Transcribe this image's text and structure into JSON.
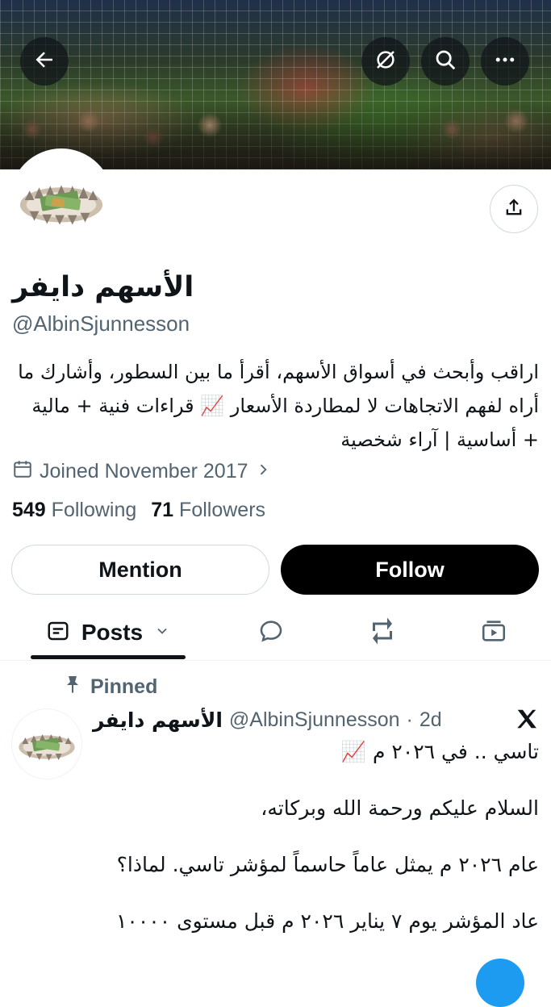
{
  "profile": {
    "display_name": "الأسهم دايفر",
    "handle": "@AlbinSjunnesson",
    "bio": "اراقب وأبحث في أسواق الأسهم، أقرأ ما بين السطور، وأشارك ما أراه لفهم الاتجاهات لا لمطاردة الأسعار 📈 قراءات فنية + مالية + أساسية | آراء شخصية",
    "joined": "Joined November 2017",
    "following_count": "549",
    "following_label": "Following",
    "followers_count": "71",
    "followers_label": "Followers"
  },
  "actions": {
    "mention_label": "Mention",
    "follow_label": "Follow"
  },
  "header_icons": [
    "back-arrow-icon",
    "hide-icon",
    "search-icon",
    "more-icon",
    "share-icon"
  ],
  "tabs": {
    "posts_label": "Posts",
    "icons": [
      "posts-icon",
      "chevron-down-icon",
      "reply-icon",
      "repost-icon",
      "media-icon"
    ]
  },
  "pinned_post": {
    "pinned_label": "Pinned",
    "author_name": "الأسهم دايفر",
    "author_handle": "@AlbinSjunnesson",
    "separator": "·",
    "time": "2d",
    "lines": [
      "تاسي .. في ٢٠٢٦ م 📈",
      "السلام عليكم ورحمة الله وبركاته،",
      "عام ٢٠٢٦ م يمثل عاماً حاسماً لمؤشر تاسي. لماذا؟",
      "عاد المؤشر يوم ٧ يناير ٢٠٢٦ م قبل مستوى ١٠٠٠٠"
    ]
  },
  "colors": {
    "text": "#0f1419",
    "secondary": "#536471",
    "border": "#cfd9de",
    "accent": "#1d9bf0"
  }
}
